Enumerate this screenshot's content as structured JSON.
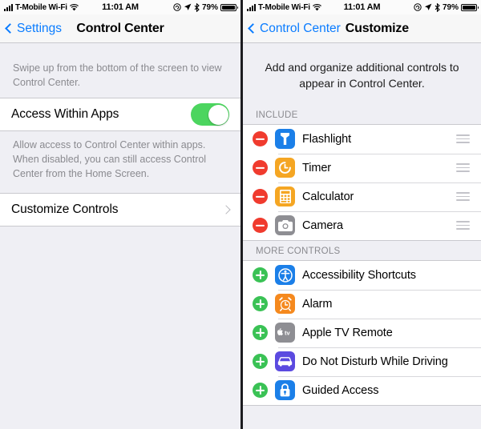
{
  "status_bar": {
    "carrier": "T-Mobile Wi-Fi",
    "time": "11:01 AM",
    "battery_percent": "79%",
    "icons": [
      "signal-bars-icon",
      "wifi-icon",
      "lock-rotation-icon",
      "location-arrow-icon",
      "bluetooth-icon",
      "battery-icon"
    ]
  },
  "left_screen": {
    "nav": {
      "back_label": "Settings",
      "title": "Control Center"
    },
    "intro": "Swipe up from the bottom of the screen to view Control Center.",
    "access_row": {
      "label": "Access Within Apps",
      "toggle_state": "on"
    },
    "footnote": "Allow access to Control Center within apps. When disabled, you can still access Control Center from the Home Screen.",
    "customize_row": {
      "label": "Customize Controls"
    }
  },
  "right_screen": {
    "nav": {
      "back_label": "Control Center",
      "title": "Customize"
    },
    "intro": "Add and organize additional controls to appear in Control Center.",
    "include_header": "INCLUDE",
    "more_header": "MORE CONTROLS",
    "include_items": [
      {
        "label": "Flashlight",
        "icon": "flashlight-icon",
        "icon_color": "#1b7fe8",
        "action": "remove"
      },
      {
        "label": "Timer",
        "icon": "timer-icon",
        "icon_color": "#f5a623",
        "action": "remove"
      },
      {
        "label": "Calculator",
        "icon": "calculator-icon",
        "icon_color": "#f5a623",
        "action": "remove"
      },
      {
        "label": "Camera",
        "icon": "camera-icon",
        "icon_color": "#8e8e93",
        "action": "remove"
      }
    ],
    "more_items": [
      {
        "label": "Accessibility Shortcuts",
        "icon": "accessibility-icon",
        "icon_color": "#1b7fe8",
        "action": "add"
      },
      {
        "label": "Alarm",
        "icon": "alarm-icon",
        "icon_color": "#f5891e",
        "action": "add"
      },
      {
        "label": "Apple TV Remote",
        "icon": "apple-tv-icon",
        "icon_color": "#8e8e93",
        "action": "add"
      },
      {
        "label": "Do Not Disturb While Driving",
        "icon": "car-icon",
        "icon_color": "#5b4ae0",
        "action": "add"
      },
      {
        "label": "Guided Access",
        "icon": "lock-icon",
        "icon_color": "#1b7fe8",
        "action": "add"
      }
    ]
  },
  "colors": {
    "accent_blue": "#0a7cff",
    "toggle_green": "#4cd55f",
    "remove_red": "#f03b2e",
    "add_green": "#3ac255",
    "page_bg": "#efeff4"
  }
}
